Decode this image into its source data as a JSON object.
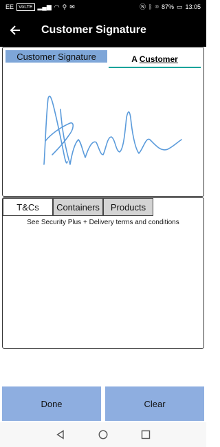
{
  "status_bar": {
    "carrier": "EE",
    "carrier_badge": "VoLTE",
    "battery_percent": "87%",
    "time": "13:05"
  },
  "toolbar": {
    "title": "Customer Signature"
  },
  "signature": {
    "label": "Customer Signature",
    "customer_prefix": "A",
    "customer_name": "Customer"
  },
  "tabs": [
    {
      "label": "T&Cs",
      "active": true
    },
    {
      "label": "Containers",
      "active": false
    },
    {
      "label": "Products",
      "active": false
    }
  ],
  "terms_text": "See Security Plus + Delivery terms and conditions",
  "buttons": {
    "done": "Done",
    "clear": "Clear"
  },
  "colors": {
    "header": "#000000",
    "accent_label": "#7ea6d8",
    "button": "#8eaee0",
    "signature_ink": "#5b9bdb",
    "underline": "#1aa39a"
  }
}
